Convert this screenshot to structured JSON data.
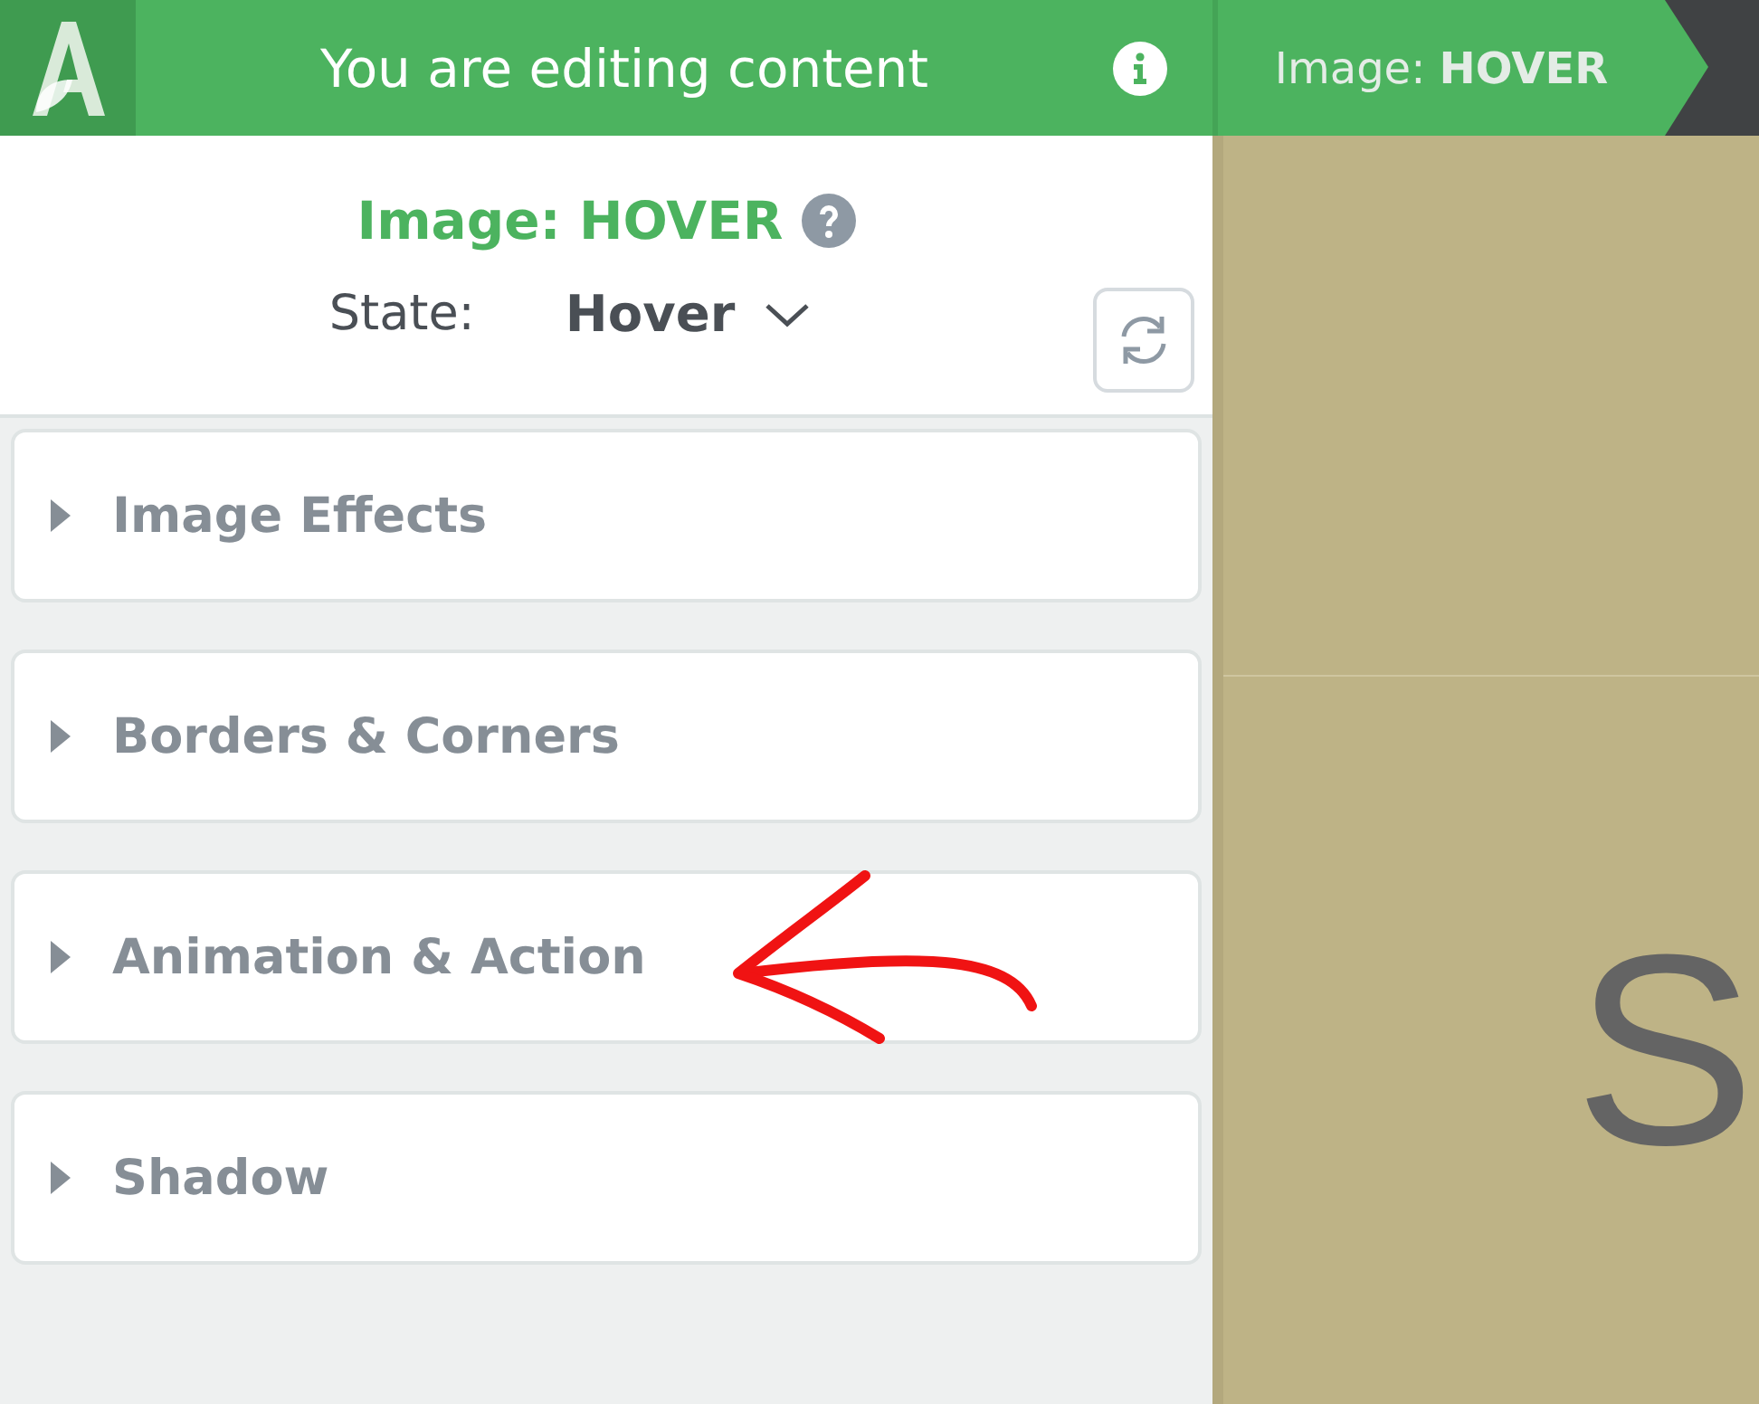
{
  "topbar": {
    "title": "You are editing content"
  },
  "breadcrumb": {
    "label": "Image: **HOVER**"
  },
  "panel": {
    "heading": "Image: HOVER",
    "state_label": "State:",
    "state_value": "Hover"
  },
  "sections": [
    {
      "label": "Image Effects",
      "expanded": false
    },
    {
      "label": "Borders & Corners",
      "expanded": false
    },
    {
      "label": "Animation & Action",
      "expanded": false
    },
    {
      "label": "Shadow",
      "expanded": false
    }
  ],
  "canvas": {
    "text": "S"
  }
}
